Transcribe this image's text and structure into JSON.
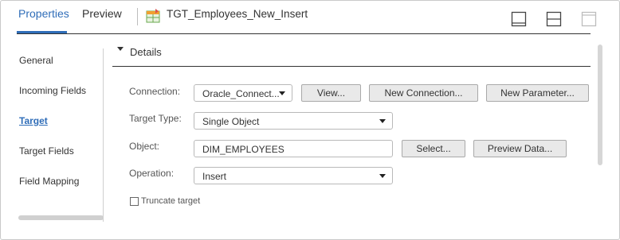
{
  "header": {
    "tabs": [
      {
        "label": "Properties",
        "active": true
      },
      {
        "label": "Preview",
        "active": false
      }
    ],
    "object_title": "TGT_Employees_New_Insert",
    "object_icon": "table-target-icon",
    "view_icons": [
      "layout-bottom-panel-icon",
      "layout-split-panel-icon",
      "layout-top-panel-icon"
    ]
  },
  "nav": {
    "items": [
      {
        "label": "General",
        "active": false
      },
      {
        "label": "Incoming Fields",
        "active": false
      },
      {
        "label": "Target",
        "active": true
      },
      {
        "label": "Target Fields",
        "active": false
      },
      {
        "label": "Field Mapping",
        "active": false
      }
    ]
  },
  "details": {
    "section_title": "Details",
    "connection": {
      "label": "Connection:",
      "value": "Oracle_Connect...",
      "buttons": [
        "View...",
        "New Connection...",
        "New Parameter..."
      ]
    },
    "target_type": {
      "label": "Target Type:",
      "value": "Single Object"
    },
    "object": {
      "label": "Object:",
      "value": "DIM_EMPLOYEES",
      "buttons": [
        "Select...",
        "Preview Data..."
      ]
    },
    "operation": {
      "label": "Operation:",
      "value": "Insert"
    },
    "truncate": {
      "label": "Truncate target",
      "checked": false
    }
  },
  "colors": {
    "accent": "#2f6db8",
    "button_bg": "#e9e9e9",
    "border": "#b9b9b9"
  }
}
